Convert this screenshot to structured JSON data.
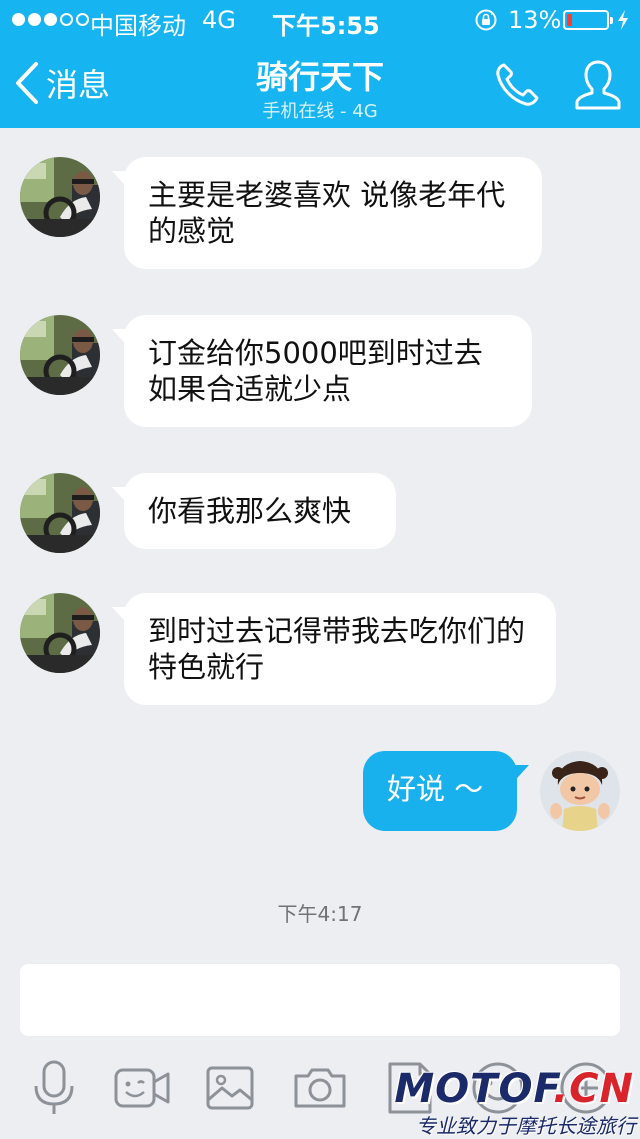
{
  "status_bar": {
    "carrier": "中国移动",
    "network": "4G",
    "time": "下午5:55",
    "battery_percent": "13%",
    "battery_level": 0.13,
    "signal_bars_filled": 3,
    "signal_bars_total": 5
  },
  "nav": {
    "back_label": "消息",
    "title": "骑行天下",
    "subtitle": "手机在线 - 4G"
  },
  "messages": [
    {
      "direction": "in",
      "text": "主要是老婆喜欢  说像老年代的感觉"
    },
    {
      "direction": "in",
      "text": "订金给你5000吧到时过去如果合适就少点"
    },
    {
      "direction": "in",
      "text": "你看我那么爽快"
    },
    {
      "direction": "in",
      "text": "到时过去记得带我去吃你们的特色就行"
    },
    {
      "direction": "out",
      "text": "好说 ～"
    }
  ],
  "timestamp": "下午4:17",
  "input": {
    "value": "",
    "placeholder": ""
  },
  "toolbar": [
    "microphone-icon",
    "video-icon",
    "image-icon",
    "camera-icon",
    "file-icon",
    "emoji-icon",
    "plus-icon"
  ],
  "watermark": {
    "main": "MOTOF",
    "suffix": ".CN",
    "sub": "专业致力于摩托长途旅行"
  },
  "colors": {
    "header": "#16b4f1",
    "background": "#eceef2",
    "outgoing_bubble": "#19b0ee",
    "incoming_bubble": "#ffffff",
    "battery_low": "#ff3b30"
  }
}
